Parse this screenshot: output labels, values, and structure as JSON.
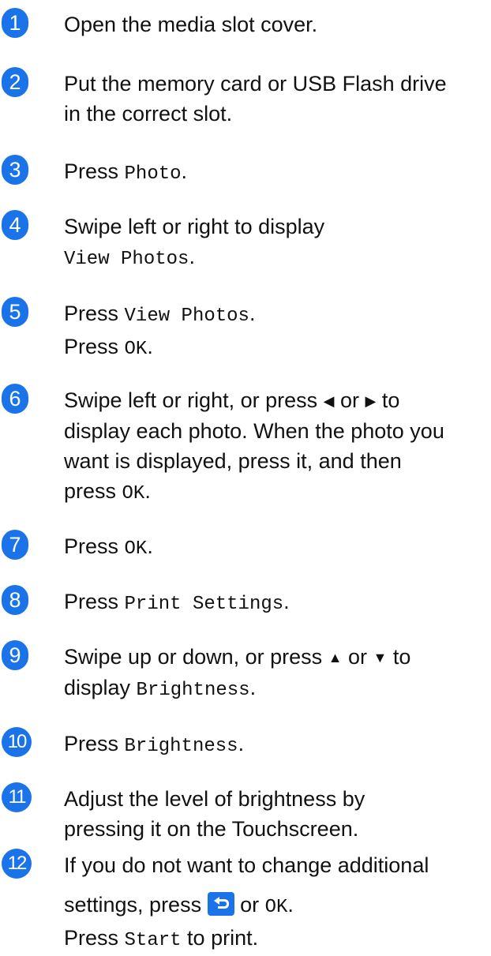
{
  "steps": [
    {
      "num": "1",
      "lines": [
        "Open the media slot cover."
      ]
    },
    {
      "num": "2",
      "lines": [
        "Put the memory card or USB Flash drive",
        "in the correct slot."
      ]
    },
    {
      "num": "3",
      "pre": "Press ",
      "code": "Photo",
      "post": "."
    },
    {
      "num": "4",
      "line1": "Swipe left or right to display",
      "code": "View Photos",
      "post": "."
    },
    {
      "num": "5",
      "pre1": "Press ",
      "code1": "View Photos",
      "post1": ".",
      "pre2": "Press ",
      "code2": "OK",
      "post2": "."
    },
    {
      "num": "6",
      "a": "Swipe left or right, or press ",
      "left_arrow": "◀",
      "or": " or ",
      "right_arrow": "▶",
      "to": " to",
      "line2": "display each photo. When the photo you",
      "line3": "want is displayed, press it, and then",
      "pre4": "press ",
      "code4": "OK",
      "post4": "."
    },
    {
      "num": "7",
      "pre": "Press ",
      "code": "OK",
      "post": "."
    },
    {
      "num": "8",
      "pre": "Press ",
      "code": "Print Settings",
      "post": "."
    },
    {
      "num": "9",
      "a": "Swipe up or down, or press ",
      "up_arrow": "▲",
      "or": " or ",
      "down_arrow": "▼",
      "to": " to",
      "pre2": "display ",
      "code2": "Brightness",
      "post2": "."
    },
    {
      "num": "10",
      "pre": "Press ",
      "code": "Brightness",
      "post": "."
    },
    {
      "num": "11",
      "lines": [
        "Adjust the level of brightness by",
        "pressing it on the Touchscreen."
      ]
    },
    {
      "num": "12",
      "line1": "If you do not want to change additional",
      "pre2": "settings, press ",
      "back_icon": "back-arrow-icon",
      "or": " or ",
      "code2": "OK",
      "post2": ".",
      "pre3": "Press ",
      "code3": "Start",
      "post3": " to print."
    }
  ],
  "colors": {
    "accent": "#1a73e8",
    "text": "#111111"
  }
}
